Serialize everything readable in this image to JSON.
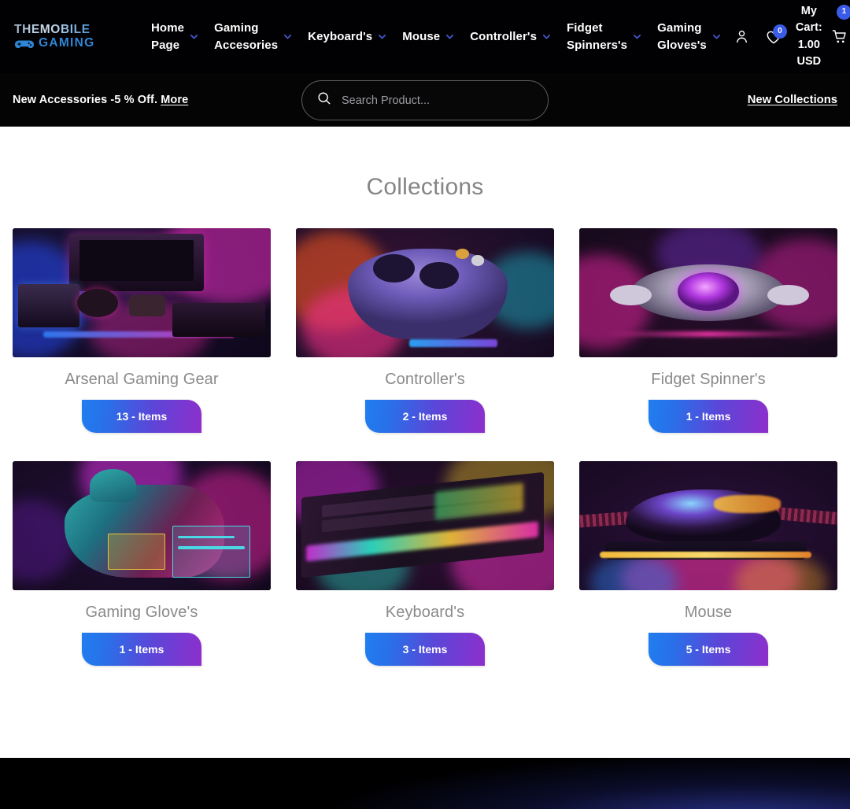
{
  "brand": {
    "line1": "THEMOBILE",
    "line2": "GAMING",
    "logo_icon": "gamepad-icon"
  },
  "nav": {
    "items": [
      {
        "label": "Home Page",
        "has_caret": true
      },
      {
        "label": "Gaming Accesories",
        "has_caret": true
      },
      {
        "label": "Keyboard's",
        "has_caret": true
      },
      {
        "label": "Mouse",
        "has_caret": true
      },
      {
        "label": "Controller's",
        "has_caret": true
      },
      {
        "label": "Fidget Spinners's",
        "has_caret": true
      },
      {
        "label": "Gaming Gloves's",
        "has_caret": true
      }
    ]
  },
  "tools": {
    "account_icon": "user-icon",
    "wishlist_icon": "heart-icon",
    "wishlist_count": "0",
    "cart_icon": "shopping-cart-icon",
    "cart_count": "1",
    "cart_label": "My Cart: 1.00 USD"
  },
  "subbar": {
    "promo_text": "New Accessories -5 % Off.",
    "promo_link": "More",
    "search_placeholder": "Search Product...",
    "search_value": "",
    "search_icon": "search-icon",
    "new_collections": "New Collections"
  },
  "main": {
    "title": "Collections",
    "collections": [
      {
        "name": "Arsenal Gaming Gear",
        "count": "13 - Items",
        "image": "neon-gaming-desk-setup"
      },
      {
        "name": "Controller's",
        "count": "2 - Items",
        "image": "purple-game-controller"
      },
      {
        "name": "Fidget Spinner's",
        "count": "1 - Items",
        "image": "metallic-fidget-spinner"
      },
      {
        "name": "Gaming Glove's",
        "count": "1 - Items",
        "image": "neon-circuit-glove"
      },
      {
        "name": "Keyboard's",
        "count": "3 - Items",
        "image": "rgb-mechanical-keyboard"
      },
      {
        "name": "Mouse",
        "count": "5 - Items",
        "image": "iridescent-gaming-mouse"
      }
    ]
  },
  "colors": {
    "nav_bg": "#010103",
    "pill_gradient_start": "#1f7ef0",
    "pill_gradient_end": "#8e2fcc",
    "badge": "#3a5ae8",
    "title_gray": "#858585",
    "footer_glow": "#2f3aa0"
  }
}
